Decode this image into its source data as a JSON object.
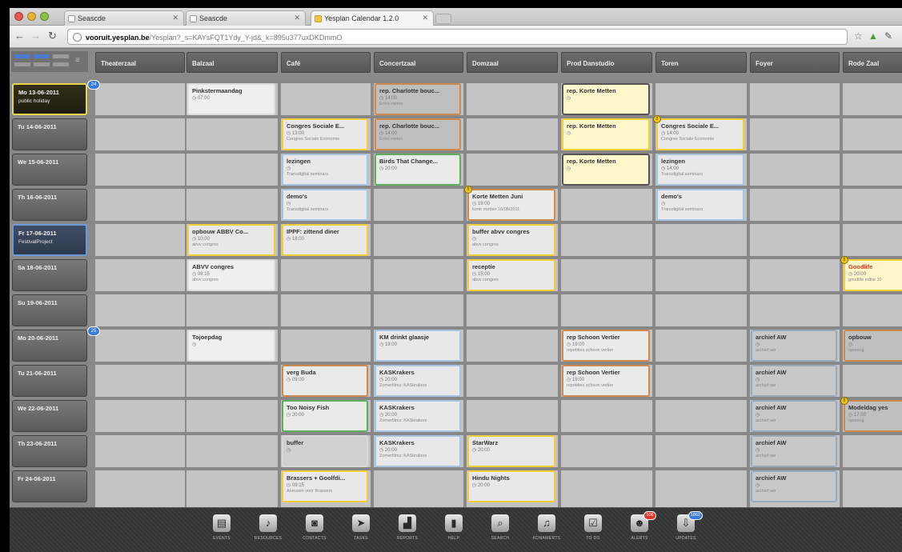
{
  "browser": {
    "tabs": [
      {
        "label": "Seascde",
        "active": false
      },
      {
        "label": "Seascde",
        "active": false
      },
      {
        "label": "Yesplan Calendar 1.2.0",
        "active": true
      }
    ],
    "url_host": "vooruit.yesplan.be",
    "url_rest": "/Yesplan?_s=KAYsFQT1Ydy_Y-jd&_k=895u377uxDKDmmO"
  },
  "columns": [
    "Theaterzaal",
    "Balzaal",
    "Café",
    "Concertzaal",
    "Domzaal",
    "Prod Danstudio",
    "Toren",
    "Foyer",
    "Rode Zaal"
  ],
  "days": [
    {
      "label": "Mo 13-06-2011",
      "sub": "public holiday",
      "style": "today"
    },
    {
      "label": "Tu 14-06-2011",
      "sub": "",
      "style": ""
    },
    {
      "label": "We 15-06-2011",
      "sub": "",
      "style": ""
    },
    {
      "label": "Th 16-06-2011",
      "sub": "",
      "style": ""
    },
    {
      "label": "Fr 17-06-2011",
      "sub": "FestivalProject",
      "style": "festival"
    },
    {
      "label": "Sa 18-06-2011",
      "sub": "",
      "style": ""
    },
    {
      "label": "Su 19-06-2011",
      "sub": "",
      "style": ""
    },
    {
      "label": "Mo 20-06-2011",
      "sub": "",
      "style": ""
    },
    {
      "label": "Tu 21-06-2011",
      "sub": "",
      "style": ""
    },
    {
      "label": "We 22-06-2011",
      "sub": "",
      "style": ""
    },
    {
      "label": "Th 23-06-2011",
      "sub": "",
      "style": ""
    },
    {
      "label": "Fr 24-06-2011",
      "sub": "",
      "style": ""
    }
  ],
  "week_badges": [
    "24",
    "25"
  ],
  "events": [
    {
      "title": "Pinkstermaandag",
      "time": "07:00",
      "note": ""
    },
    {
      "title": "rep. Charlotte bouc...",
      "time": "14:00",
      "note": "Echo meten"
    },
    {
      "title": "rep. Korte Metten",
      "time": "",
      "note": ""
    },
    {
      "title": "Congres Sociale E...",
      "time": "13:00",
      "note": "Congres Sociale Economie"
    },
    {
      "title": "rep. Charlotte bouc...",
      "time": "14:00",
      "note": "Echo meten"
    },
    {
      "title": "rep. Korte Metten",
      "time": "",
      "note": ""
    },
    {
      "title": "Congres Sociale E...",
      "time": "14:00",
      "note": "Congres Sociale Economie"
    },
    {
      "title": "lezingen",
      "time": "",
      "note": "Transdigital seminars"
    },
    {
      "title": "Birds That Change...",
      "time": "20:00",
      "note": ""
    },
    {
      "title": "rep. Korte Metten",
      "time": "",
      "note": ""
    },
    {
      "title": "lezingen",
      "time": "14:00",
      "note": "Transdigital seminars"
    },
    {
      "title": "demo's",
      "time": "",
      "note": "Transdigital seminars"
    },
    {
      "title": "Korte Metten Juni",
      "time": "19:00",
      "note": "korte metten 16/06/2011"
    },
    {
      "title": "demo's",
      "time": "",
      "note": "Transdigital seminars"
    },
    {
      "title": "opbouw ABBV Co...",
      "time": "10:00",
      "note": "abvv congres"
    },
    {
      "title": "IPPF: zittend diner",
      "time": "18:00",
      "note": ""
    },
    {
      "title": "buffer abvv congres",
      "time": "",
      "note": "abvv congres"
    },
    {
      "title": "ABVV congres",
      "time": "08:15",
      "note": "abvv congres"
    },
    {
      "title": "receptie",
      "time": "15:00",
      "note": "abvv congres"
    },
    {
      "title": "Goodlife",
      "time": "20:00",
      "note": "goodlife editie 10"
    },
    {
      "title": "Tojoepdag",
      "time": "",
      "note": ""
    },
    {
      "title": "KM drinkt glaasje",
      "time": "19:00",
      "note": ""
    },
    {
      "title": "rep Schoon Vertier",
      "time": "19:00",
      "note": "repetities schoon vertier"
    },
    {
      "title": "archief AW",
      "time": "",
      "note": "archief aw"
    },
    {
      "title": "opbouw",
      "time": "",
      "note": "opening"
    },
    {
      "title": "verg Buda",
      "time": "09:00",
      "note": ""
    },
    {
      "title": "KASKrakers",
      "time": "20:00",
      "note": "Zomerfilms: KASkrakers"
    },
    {
      "title": "rep Schoon Vertier",
      "time": "19:00",
      "note": "repetities schoon vertier"
    },
    {
      "title": "archief AW",
      "time": "",
      "note": "archief aw"
    },
    {
      "title": "Too Noisy Fish",
      "time": "20:00",
      "note": ""
    },
    {
      "title": "KASKrakers",
      "time": "20:00",
      "note": "Zomerfilms: KASkrakers"
    },
    {
      "title": "archief AW",
      "time": "",
      "note": "archief aw"
    },
    {
      "title": "Modeldag yes",
      "time": "17:00",
      "note": "opening"
    },
    {
      "title": "buffer",
      "time": "",
      "note": ""
    },
    {
      "title": "KASKrakers",
      "time": "20:00",
      "note": "Zomerfilms: KASkrakers"
    },
    {
      "title": "StarWarz",
      "time": "20:00",
      "note": ""
    },
    {
      "title": "archief AW",
      "time": "",
      "note": "archief aw"
    },
    {
      "title": "Brassers + Goolfdi...",
      "time": "09:15",
      "note": "Aneusen voor Brassers"
    },
    {
      "title": "Hindu Nights",
      "time": "20:00",
      "note": ""
    },
    {
      "title": "archief AW",
      "time": "",
      "note": "archief aw"
    }
  ],
  "toolbar": [
    {
      "label": "EVENTS",
      "icon": "calendar-icon",
      "glyph": "▤"
    },
    {
      "label": "RESOURCES",
      "icon": "microphone-icon",
      "glyph": "♪"
    },
    {
      "label": "CONTACTS",
      "icon": "contacts-icon",
      "glyph": "◙"
    },
    {
      "label": "TASKS",
      "icon": "paper-plane-icon",
      "glyph": "➤"
    },
    {
      "label": "REPORTS",
      "icon": "chart-icon",
      "glyph": "▟"
    },
    {
      "label": "HELP",
      "icon": "book-icon",
      "glyph": "▮"
    },
    {
      "label": "SEARCH",
      "icon": "search-icon",
      "glyph": "⌕"
    },
    {
      "label": "KONAWERTS",
      "icon": "headphones-icon",
      "glyph": "♫"
    },
    {
      "label": "TO DO",
      "icon": "checkbox-icon",
      "glyph": "☑"
    },
    {
      "label": "ALERTS",
      "icon": "alert-icon",
      "glyph": "☻",
      "badge": "106",
      "badge_color": "#d9372a"
    },
    {
      "label": "UPDATES",
      "icon": "download-icon",
      "glyph": "⇩",
      "badge": "1862",
      "badge_color": "#3b7ad6"
    }
  ],
  "colors": {
    "accent_gold": "#f2cf3a",
    "accent_orange": "#d08a4d",
    "accent_green": "#5fae5a",
    "accent_blue": "#a9c3e4",
    "today_border": "#e7d44a"
  }
}
